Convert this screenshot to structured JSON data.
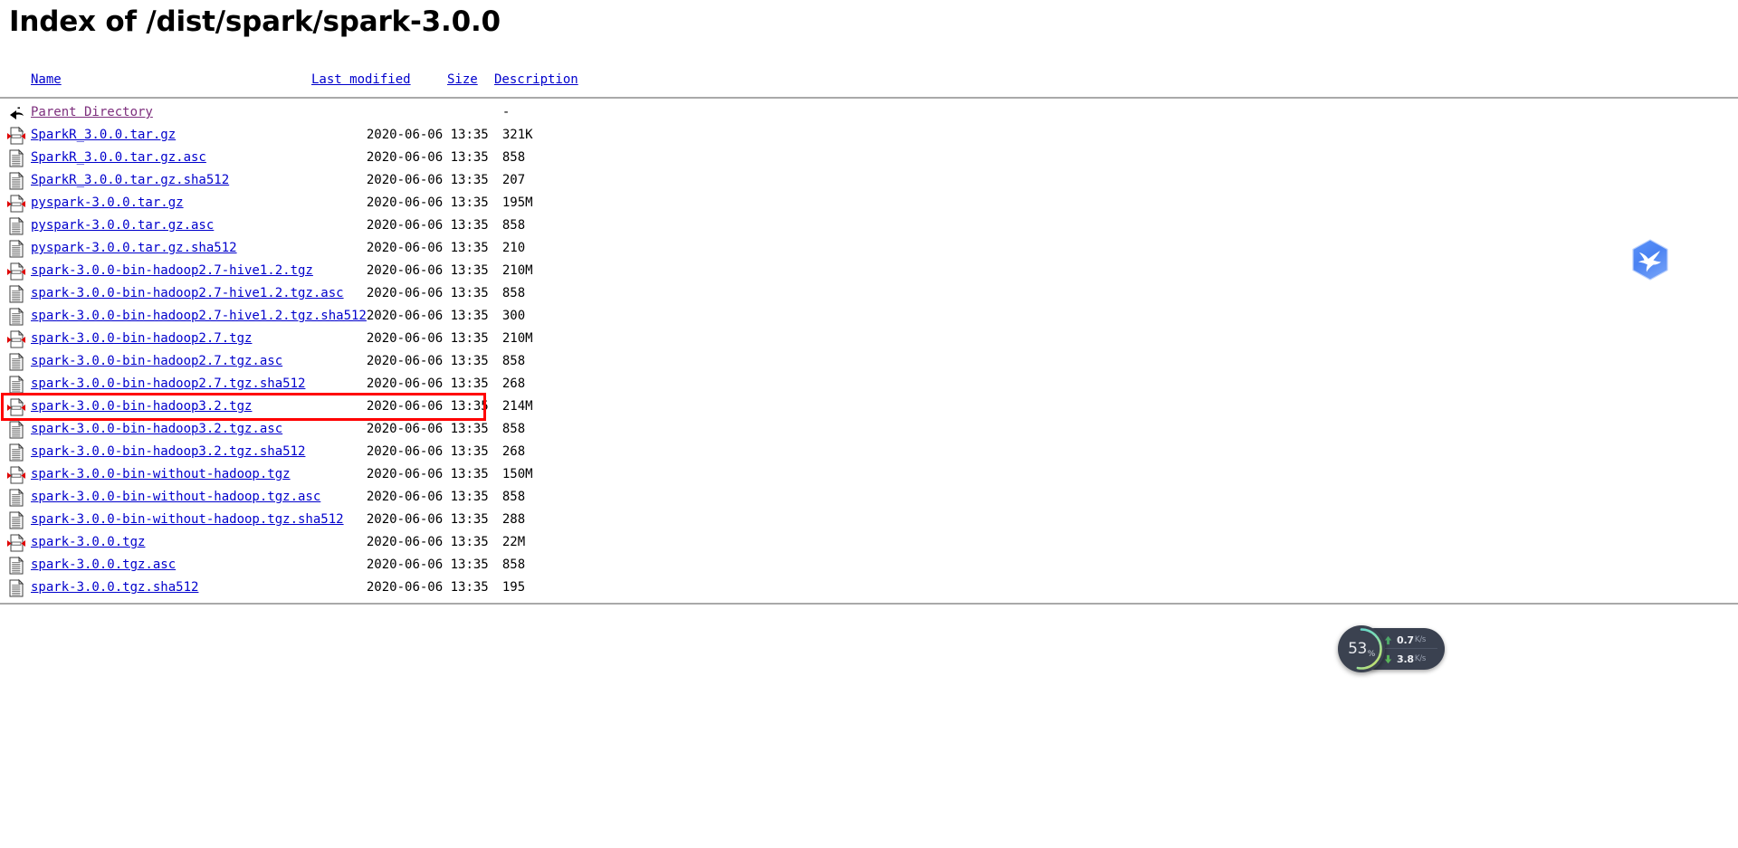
{
  "page": {
    "title": "Index of /dist/spark/spark-3.0.0"
  },
  "table": {
    "headers": {
      "name": "Name",
      "last_modified": "Last modified",
      "size": "Size",
      "description": "Description"
    },
    "parent": {
      "icon": "back-icon",
      "label": "Parent Directory",
      "last_modified": "",
      "size": "-",
      "description": ""
    },
    "rows": [
      {
        "icon": "compressed-file-icon",
        "name": "SparkR_3.0.0.tar.gz",
        "last_modified": "2020-06-06 13:35",
        "size": "321K",
        "description": ""
      },
      {
        "icon": "text-file-icon",
        "name": "SparkR_3.0.0.tar.gz.asc",
        "last_modified": "2020-06-06 13:35",
        "size": "858",
        "description": ""
      },
      {
        "icon": "text-file-icon",
        "name": "SparkR_3.0.0.tar.gz.sha512",
        "last_modified": "2020-06-06 13:35",
        "size": "207",
        "description": ""
      },
      {
        "icon": "compressed-file-icon",
        "name": "pyspark-3.0.0.tar.gz",
        "last_modified": "2020-06-06 13:35",
        "size": "195M",
        "description": ""
      },
      {
        "icon": "text-file-icon",
        "name": "pyspark-3.0.0.tar.gz.asc",
        "last_modified": "2020-06-06 13:35",
        "size": "858",
        "description": ""
      },
      {
        "icon": "text-file-icon",
        "name": "pyspark-3.0.0.tar.gz.sha512",
        "last_modified": "2020-06-06 13:35",
        "size": "210",
        "description": ""
      },
      {
        "icon": "compressed-file-icon",
        "name": "spark-3.0.0-bin-hadoop2.7-hive1.2.tgz",
        "last_modified": "2020-06-06 13:35",
        "size": "210M",
        "description": ""
      },
      {
        "icon": "text-file-icon",
        "name": "spark-3.0.0-bin-hadoop2.7-hive1.2.tgz.asc",
        "last_modified": "2020-06-06 13:35",
        "size": "858",
        "description": ""
      },
      {
        "icon": "text-file-icon",
        "name": "spark-3.0.0-bin-hadoop2.7-hive1.2.tgz.sha512",
        "last_modified": "2020-06-06 13:35",
        "size": "300",
        "description": ""
      },
      {
        "icon": "compressed-file-icon",
        "name": "spark-3.0.0-bin-hadoop2.7.tgz",
        "last_modified": "2020-06-06 13:35",
        "size": "210M",
        "description": ""
      },
      {
        "icon": "text-file-icon",
        "name": "spark-3.0.0-bin-hadoop2.7.tgz.asc",
        "last_modified": "2020-06-06 13:35",
        "size": "858",
        "description": ""
      },
      {
        "icon": "text-file-icon",
        "name": "spark-3.0.0-bin-hadoop2.7.tgz.sha512",
        "last_modified": "2020-06-06 13:35",
        "size": "268",
        "description": ""
      },
      {
        "icon": "compressed-file-icon",
        "name": "spark-3.0.0-bin-hadoop3.2.tgz",
        "last_modified": "2020-06-06 13:35",
        "size": "214M",
        "description": "",
        "highlighted": true
      },
      {
        "icon": "text-file-icon",
        "name": "spark-3.0.0-bin-hadoop3.2.tgz.asc",
        "last_modified": "2020-06-06 13:35",
        "size": "858",
        "description": ""
      },
      {
        "icon": "text-file-icon",
        "name": "spark-3.0.0-bin-hadoop3.2.tgz.sha512",
        "last_modified": "2020-06-06 13:35",
        "size": "268",
        "description": ""
      },
      {
        "icon": "compressed-file-icon",
        "name": "spark-3.0.0-bin-without-hadoop.tgz",
        "last_modified": "2020-06-06 13:35",
        "size": "150M",
        "description": ""
      },
      {
        "icon": "text-file-icon",
        "name": "spark-3.0.0-bin-without-hadoop.tgz.asc",
        "last_modified": "2020-06-06 13:35",
        "size": "858",
        "description": ""
      },
      {
        "icon": "text-file-icon",
        "name": "spark-3.0.0-bin-without-hadoop.tgz.sha512",
        "last_modified": "2020-06-06 13:35",
        "size": "288",
        "description": ""
      },
      {
        "icon": "compressed-file-icon",
        "name": "spark-3.0.0.tgz",
        "last_modified": "2020-06-06 13:35",
        "size": "22M",
        "description": ""
      },
      {
        "icon": "text-file-icon",
        "name": "spark-3.0.0.tgz.asc",
        "last_modified": "2020-06-06 13:35",
        "size": "858",
        "description": ""
      },
      {
        "icon": "text-file-icon",
        "name": "spark-3.0.0.tgz.sha512",
        "last_modified": "2020-06-06 13:35",
        "size": "195",
        "description": ""
      }
    ]
  },
  "overlays": {
    "highlight_color": "#ff0000",
    "brand_icon": {
      "name": "thunder-bird-hexagon-icon",
      "color": "#4a86f7"
    }
  },
  "network_widget": {
    "percent": "53",
    "percent_sign": "%",
    "upload": {
      "icon": "arrow-up-icon",
      "value": "0.7",
      "unit": "K/s"
    },
    "download": {
      "icon": "arrow-down-icon",
      "value": "3.8",
      "unit": "K/s"
    },
    "ring_start_color": "#55d6e0",
    "ring_end_color": "#d7e05a",
    "background_color": "#3a4150"
  }
}
